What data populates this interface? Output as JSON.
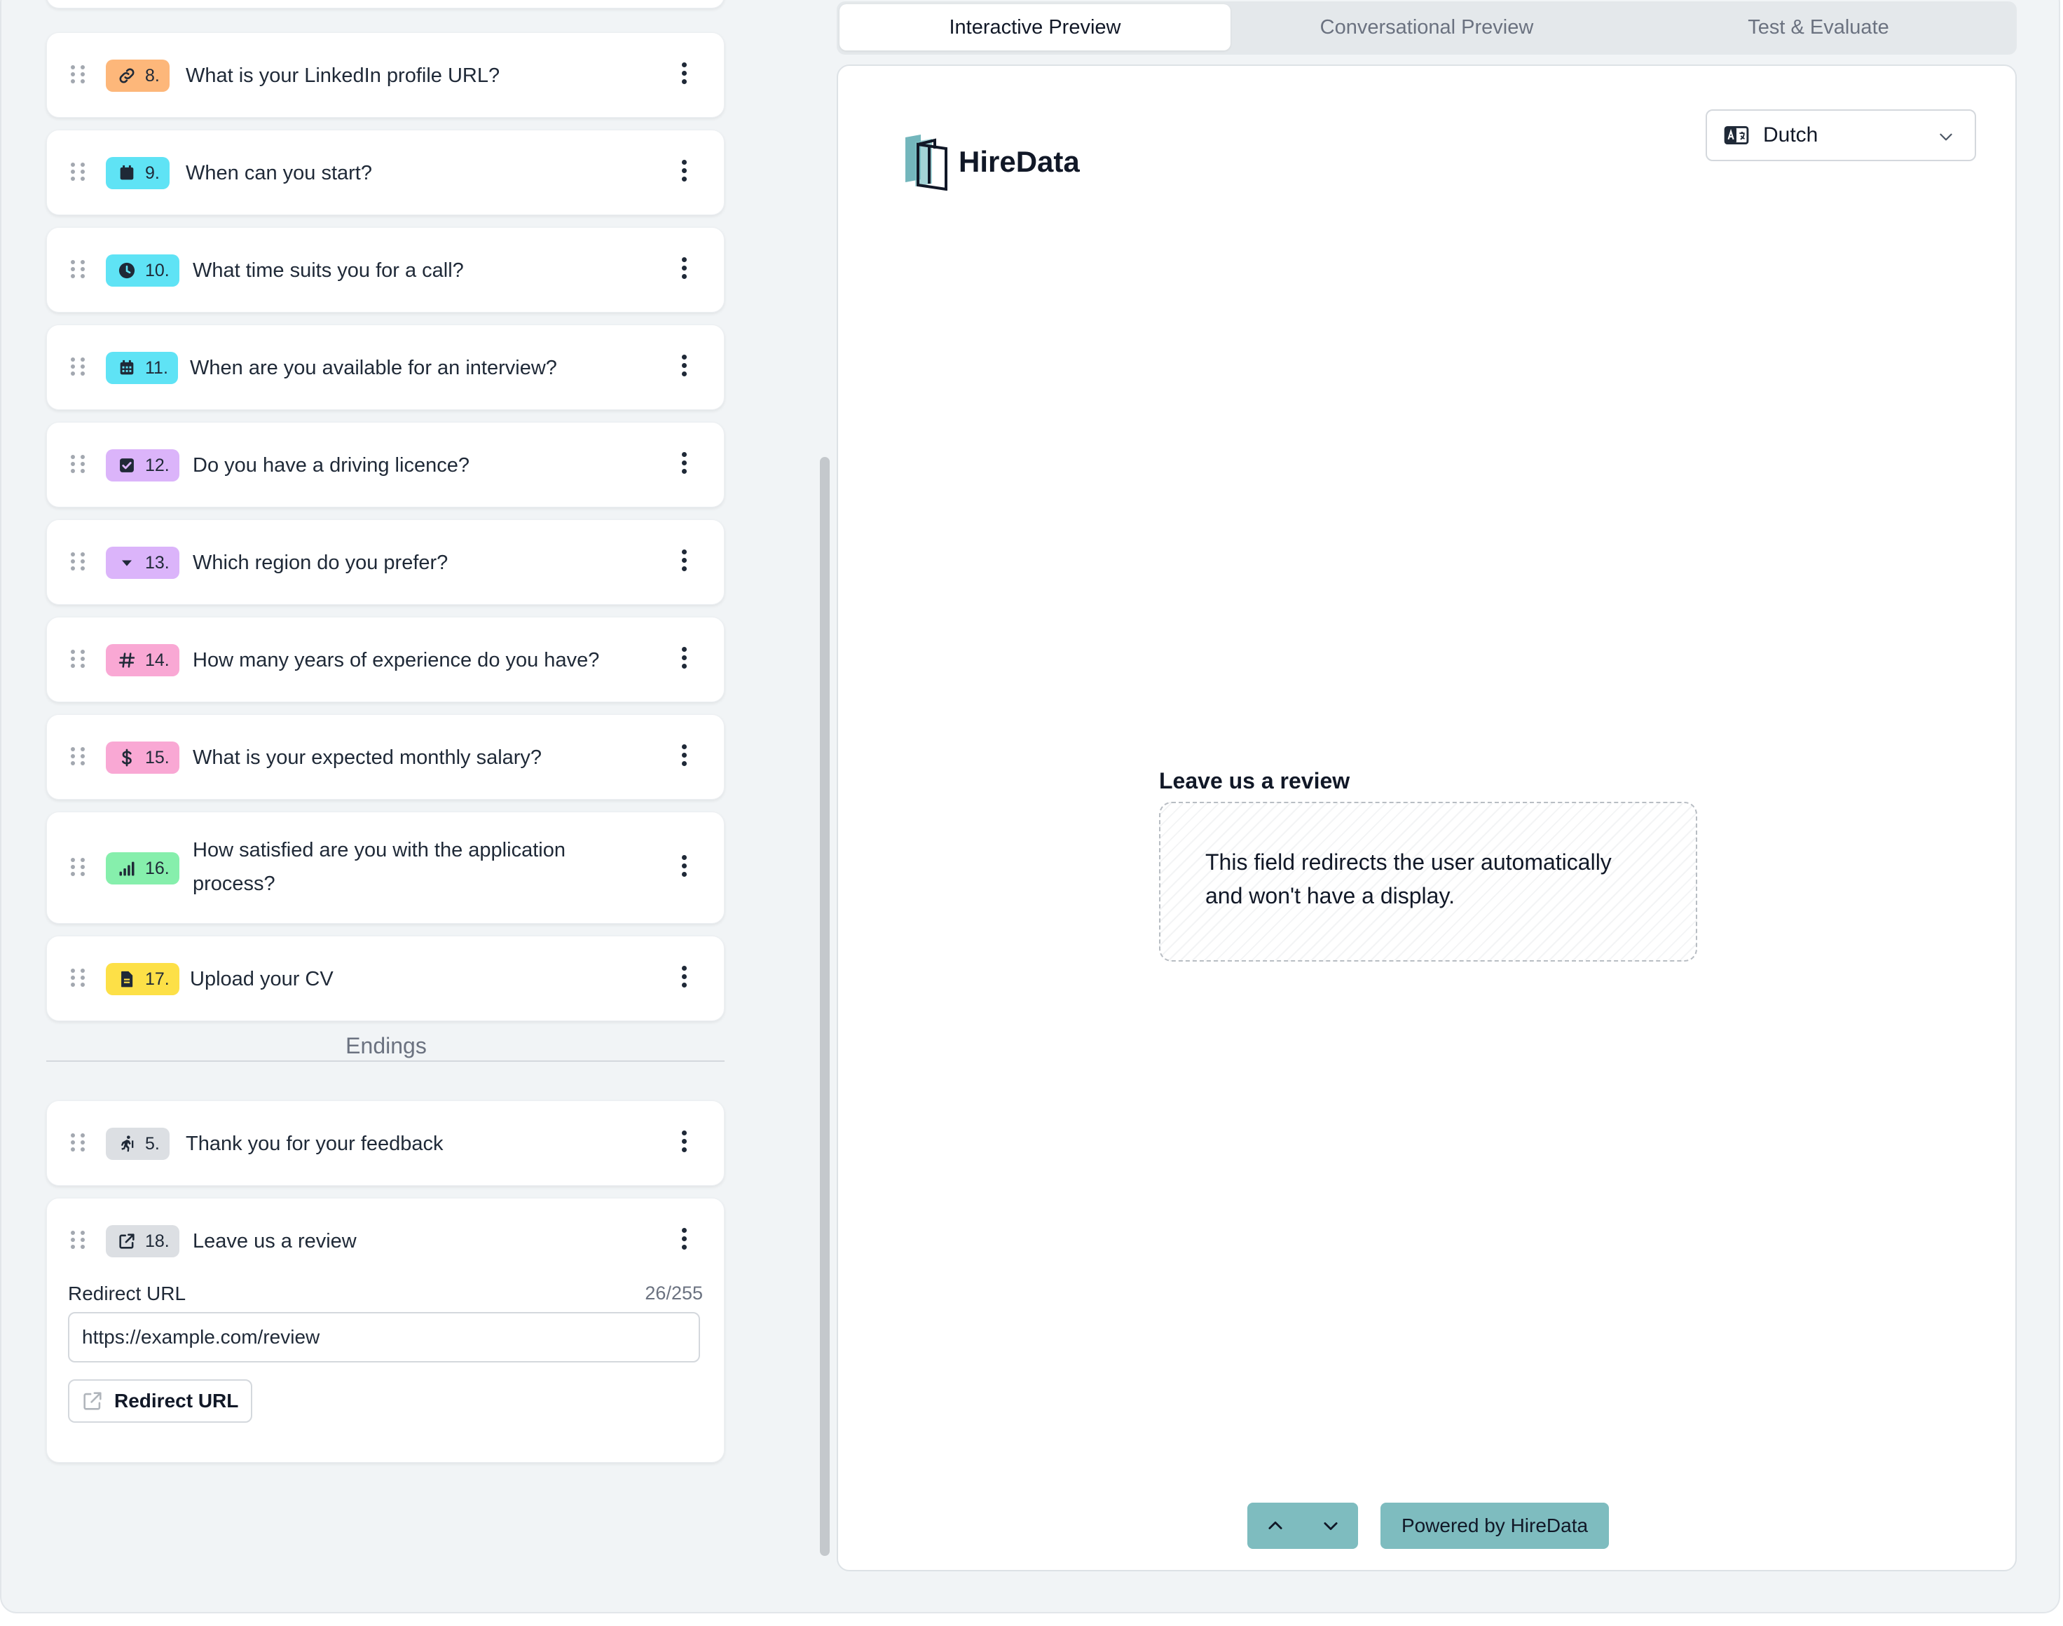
{
  "questions": [
    {
      "number": "8.",
      "text": "What is your LinkedIn profile URL?",
      "icon": "link-icon",
      "color": "#fdb77a"
    },
    {
      "number": "9.",
      "text": "When can you start?",
      "icon": "calendar-icon",
      "color": "#5fe3f5"
    },
    {
      "number": "10.",
      "text": "What time suits you for a call?",
      "icon": "clock-icon",
      "color": "#5fe3f5"
    },
    {
      "number": "11.",
      "text": "When are you available for an interview?",
      "icon": "calendar-grid-icon",
      "color": "#5fe3f5"
    },
    {
      "number": "12.",
      "text": "Do you have a driving licence?",
      "icon": "checkbox-icon",
      "color": "#dbb4fa"
    },
    {
      "number": "13.",
      "text": "Which region do you prefer?",
      "icon": "dropdown-icon",
      "color": "#dbb4fa"
    },
    {
      "number": "14.",
      "text": "How many years of experience do you have?",
      "icon": "hash-icon",
      "color": "#f9a8d4"
    },
    {
      "number": "15.",
      "text": "What is your expected monthly salary?",
      "icon": "dollar-icon",
      "color": "#f9a8d4"
    },
    {
      "number": "16.",
      "text_line1": "How satisfied are you with the application",
      "text_line2": "process?",
      "icon": "signal-bars-icon",
      "color": "#86efac"
    },
    {
      "number": "17.",
      "text": "Upload your CV",
      "icon": "file-icon",
      "color": "#fde047"
    }
  ],
  "endings_label": "Endings",
  "endings": [
    {
      "number": "5.",
      "text": "Thank you for your feedback",
      "icon": "exit-icon",
      "color": "#dcdfe3"
    },
    {
      "number": "18.",
      "text": "Leave us a review",
      "icon": "external-link-icon",
      "color": "#dcdfe3"
    }
  ],
  "redirect": {
    "label": "Redirect URL",
    "counter": "26/255",
    "value": "https://example.com/review",
    "button_label": "Redirect URL"
  },
  "tabs": [
    "Interactive Preview",
    "Conversational Preview",
    "Test & Evaluate"
  ],
  "active_tab": "Interactive Preview",
  "preview": {
    "brand": "HireData",
    "language": "Dutch",
    "review_title": "Leave us a review",
    "review_message": "This field redirects the user automatically and won't have a display.",
    "powered_by": "Powered by HireData"
  },
  "colors": {
    "accent": "#7ebcbf",
    "background": "#f1f4f6"
  }
}
